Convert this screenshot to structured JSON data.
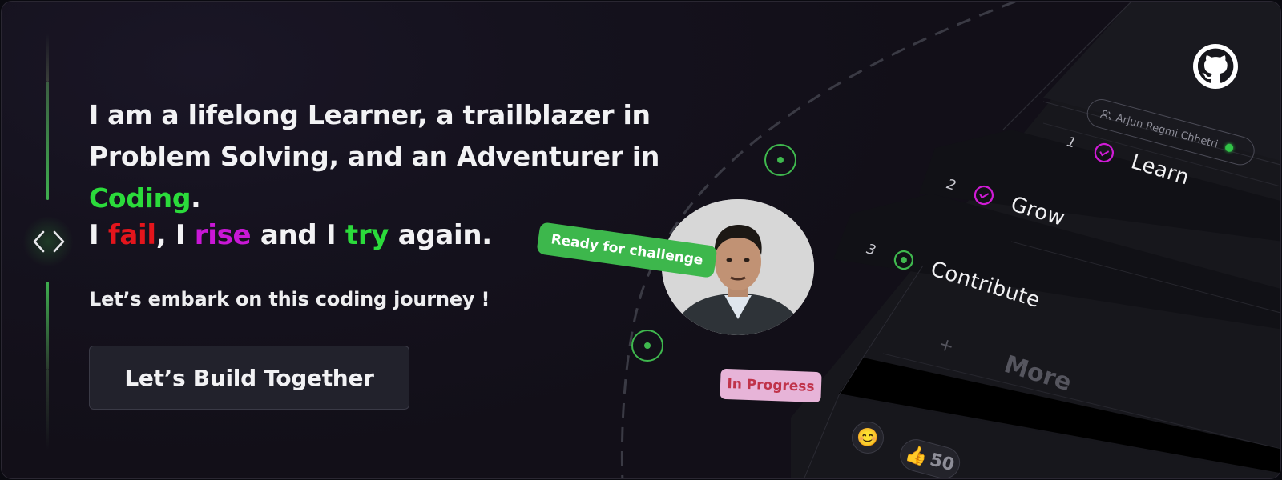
{
  "headline": {
    "part1": "I am a lifelong Learner,  a trailblazer  in Problem Solving, and an Adventurer in ",
    "highlight": "Coding",
    "end": "."
  },
  "motto": {
    "w1": "I ",
    "fail": "fail",
    "w2": ", I ",
    "rise": "rise",
    "w3": " and I ",
    "try": "try",
    "w4": " again."
  },
  "subtitle": "Let’s embark on this coding journey !",
  "cta_label": "Let’s Build Together",
  "tags": {
    "challenge": "Ready for challenge",
    "progress": "In Progress"
  },
  "user": {
    "name": "Arjun Regmi Chhetri",
    "status": "online"
  },
  "steps": [
    {
      "num": "1",
      "label": "Learn"
    },
    {
      "num": "2",
      "label": "Grow"
    },
    {
      "num": "3",
      "label": "Contribute"
    }
  ],
  "more": {
    "plus": "+",
    "label": "More"
  },
  "reactions": {
    "emoji": "😊",
    "thumbs": "👍",
    "count": "50"
  },
  "colors": {
    "accent_green": "#2bdb3b",
    "fail_red": "#e3151c",
    "rise_magenta": "#c917d6",
    "tag_green": "#3db74c",
    "tag_pink": "#e7b4d8",
    "check_magenta": "#d01bd6"
  },
  "icons": [
    "code-brackets-icon",
    "github-icon",
    "user-icon",
    "check-circle-icon",
    "dot-circle-icon",
    "smiley-icon",
    "thumbs-up-icon"
  ]
}
